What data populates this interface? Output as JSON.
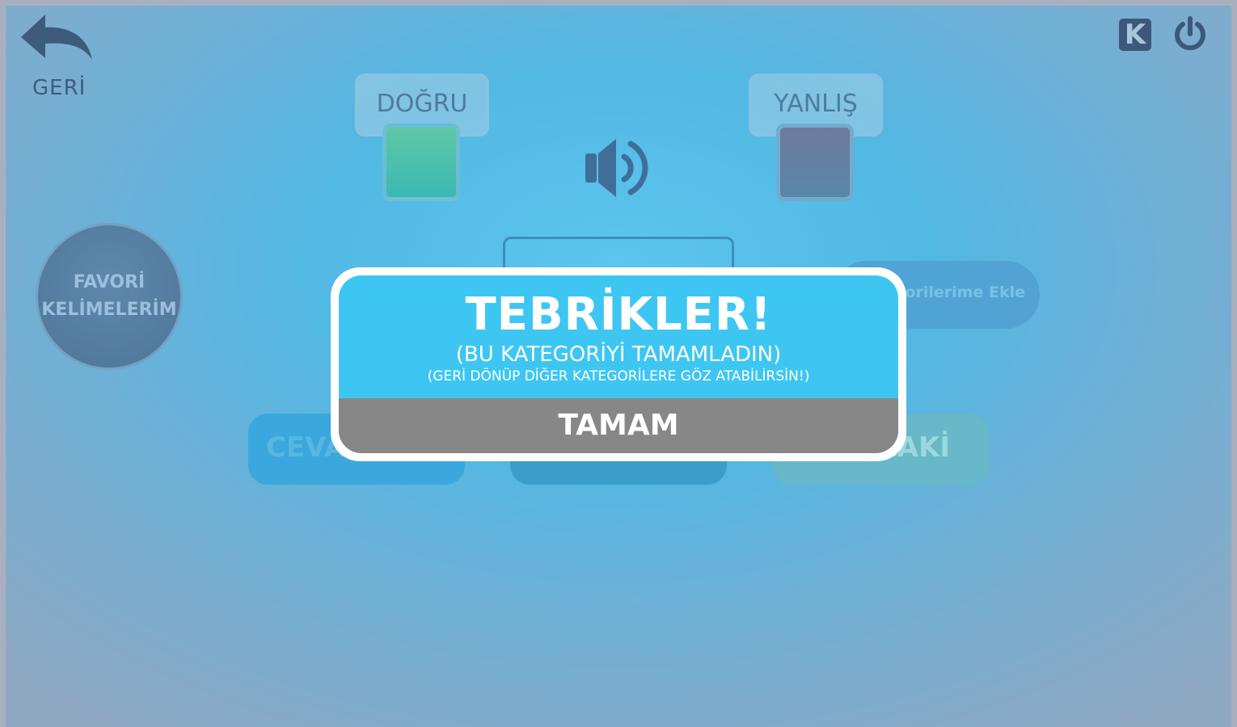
{
  "header": {
    "back_label": "GERİ",
    "k_label": "K"
  },
  "answers": {
    "correct_label": "DOĞRU",
    "wrong_label": "YANLIŞ"
  },
  "favorites": {
    "line1": "FAVORİ",
    "line2": "KELİMELERİM",
    "add_label": "Favorilerime Ekle"
  },
  "actions": {
    "answer_label": "CEVAP",
    "middle_label": "",
    "next_label": "SONRAKİ"
  },
  "modal": {
    "title": "TEBRİKLER!",
    "subtitle": "(BU KATEGORİYİ TAMAMLADIN)",
    "note": "(GERİ DÖNÜP DİĞER KATEGORİLERE GÖZ ATABİLİRSİN!)",
    "ok_label": "TAMAM"
  }
}
